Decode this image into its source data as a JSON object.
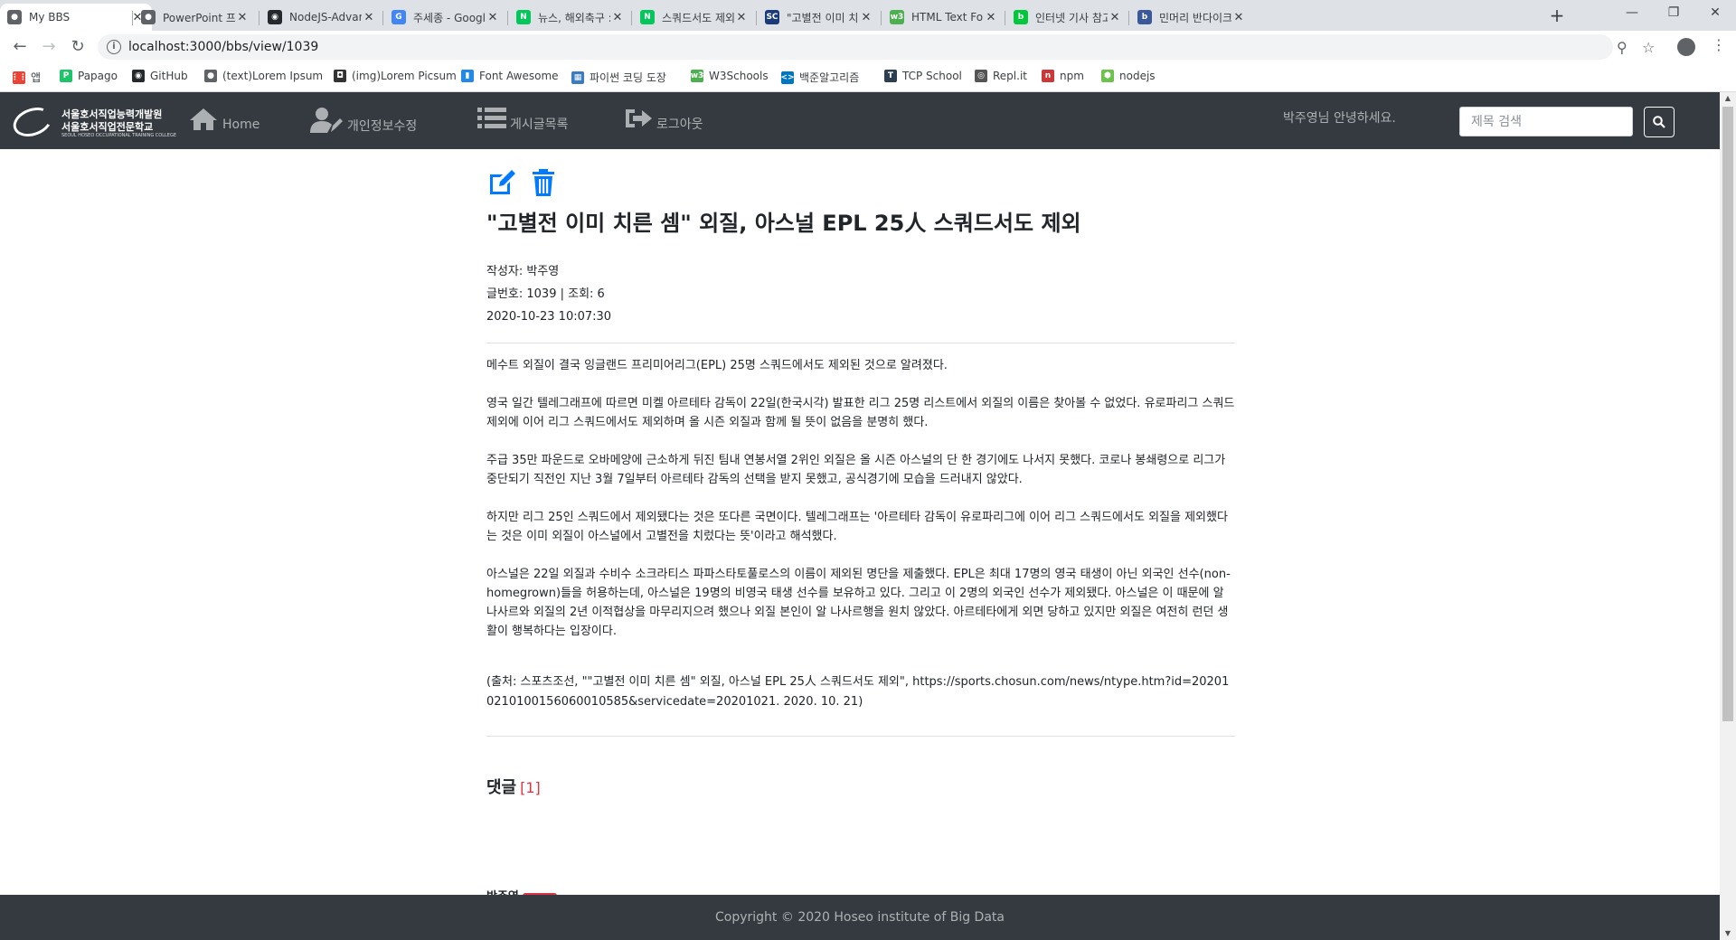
{
  "browser": {
    "tabs": [
      {
        "title": "My BBS",
        "favicon": "globe-icon",
        "color": "#5f6368"
      },
      {
        "title": "PowerPoint 프레젠",
        "favicon": "globe-icon",
        "color": "#5f6368"
      },
      {
        "title": "NodeJS-Advanced-",
        "favicon": "github-icon",
        "color": "#24292e"
      },
      {
        "title": "주세종 - Google 검",
        "favicon": "google-icon",
        "color": "#4285f4"
      },
      {
        "title": "뉴스, 해외축구 : 네",
        "favicon": "naver-icon",
        "color": "#03c75a"
      },
      {
        "title": "스쿼드서도 제외 : N",
        "favicon": "naver-icon",
        "color": "#03c75a"
      },
      {
        "title": "\"고별전 이미 치른",
        "favicon": "sc-icon",
        "color": "#1a3a7a"
      },
      {
        "title": "HTML Text Formatt",
        "favicon": "w3-icon",
        "color": "#4caf50"
      },
      {
        "title": "인터넷 기사 참고문",
        "favicon": "blog-icon",
        "color": "#00c73c"
      },
      {
        "title": "민머리 반다이크?..",
        "favicon": "blog-icon",
        "color": "#3b5998"
      }
    ],
    "url": "localhost:3000/bbs/view/1039",
    "bookmarks": [
      {
        "label": "앱",
        "icon": "apps-grid-icon",
        "color": "#ea4335"
      },
      {
        "label": "Papago",
        "icon": "papago-icon",
        "color": "#1fc46a"
      },
      {
        "label": "GitHub",
        "icon": "github-icon",
        "color": "#24292e"
      },
      {
        "label": "(text)Lorem Ipsum",
        "icon": "globe-icon",
        "color": "#5f6368"
      },
      {
        "label": "(img)Lorem Picsum",
        "icon": "camera-icon",
        "color": "#333333"
      },
      {
        "label": "Font Awesome",
        "icon": "flag-icon",
        "color": "#228ae6"
      },
      {
        "label": "파이썬 코딩 도장",
        "icon": "dojo-icon",
        "color": "#3b7bbf"
      },
      {
        "label": "W3Schools",
        "icon": "w3-icon",
        "color": "#4caf50"
      },
      {
        "label": "백준알고리즘",
        "icon": "code-icon",
        "color": "#0076c0"
      },
      {
        "label": "TCP School",
        "icon": "tcp-icon",
        "color": "#2c3e50"
      },
      {
        "label": "Repl.it",
        "icon": "replit-icon",
        "color": "#555555"
      },
      {
        "label": "npm",
        "icon": "npm-icon",
        "color": "#cb3837"
      },
      {
        "label": "nodejs",
        "icon": "nodejs-icon",
        "color": "#6cc24a"
      }
    ]
  },
  "site": {
    "logo": {
      "line1": "서울호서직업능력개발원",
      "line2": "서울호서직업전문학교",
      "line3": "SEOUL HOSEO OCCUPATIONAL TRAINING COLLEGE"
    },
    "nav": [
      {
        "label": "Home",
        "icon": "home-icon"
      },
      {
        "label": "개인정보수정",
        "icon": "user-edit-icon"
      },
      {
        "label": "게시글목록",
        "icon": "list-icon"
      },
      {
        "label": "로그아웃",
        "icon": "sign-out-icon"
      }
    ],
    "greeting": "박주영님 안녕하세요.",
    "search_placeholder": "제목 검색",
    "accent": "#007bff",
    "navbar_color": "#343a40"
  },
  "post": {
    "title": "\"고별전 이미 치른 셈\" 외질, 아스널 EPL 25人 스쿼드서도 제외",
    "author_line": "작성자: 박주영",
    "number_line": "글번호: 1039 | 조회: 6",
    "date": "2020-10-23 10:07:30",
    "paragraphs": [
      "메수트 외질이 결국 잉글랜드 프리미어리그(EPL) 25명 스쿼드에서도 제외된 것으로 알려졌다.",
      "영국 일간 텔레그래프에 따르면 미켈 아르테타 감독이 22일(한국시각) 발표한 리그 25명 리스트에서 외질의 이름은 찾아볼 수 없었다. 유로파리그 스쿼드 제외에 이어 리그 스쿼드에서도 제외하며 올 시즌 외질과 함께 될 뜻이 없음을 분명히 했다.",
      "주급 35만 파운드로 오바메양에 근소하게 뒤진 팀내 연봉서열 2위인 외질은 올 시즌 아스널의 단 한 경기에도 나서지 못했다. 코로나 봉쇄령으로 리그가 중단되기 직전인 지난 3월 7일부터 아르테타 감독의 선택을 받지 못했고, 공식경기에 모습을 드러내지 않았다.",
      "하지만 리그 25인 스쿼드에서 제외됐다는 것은 또다른 국면이다. 텔레그래프는 '아르테타 감독이 유로파리그에 이어 리그 스쿼드에서도 외질을 제외했다는 것은 이미 외질이 아스널에서 고별전을 치렀다는 뜻'이라고 해석했다.",
      "아스널은 22일 외질과 수비수 소크라티스 파파스타토풀로스의 이름이 제외된 명단을 제출했다. EPL은 최대 17명의 영국 태생이 아닌 외국인 선수(non-homegrown)들을 허용하는데, 아스널은 19명의 비영국 태생 선수를 보유하고 있다. 그리고 이 2명의 외국인 선수가 제외됐다. 아스널은 이 때문에 알 나사르와 외질의 2년 이적협상을 마무리지으려 했으나 외질 본인이 알 나사르행을 원치 않았다. 아르테타에게 외면 당하고 있지만 외질은 여전히 런던 생활이 행복하다는 입장이다."
    ],
    "source": "(출처: 스포츠조선, \"\"고별전 이미 치른 셈\" 외질, 아스널 EPL 25人 스쿼드서도 제외\", https://sports.chosun.com/news/ntype.htm?id=202010210100156060010585&servicedate=20201021. 2020. 10. 21)"
  },
  "comments": {
    "heading": "댓글",
    "count": "[1]",
    "first_author": "박주영"
  },
  "footer": "Copyright © 2020 Hoseo institute of Big Data"
}
